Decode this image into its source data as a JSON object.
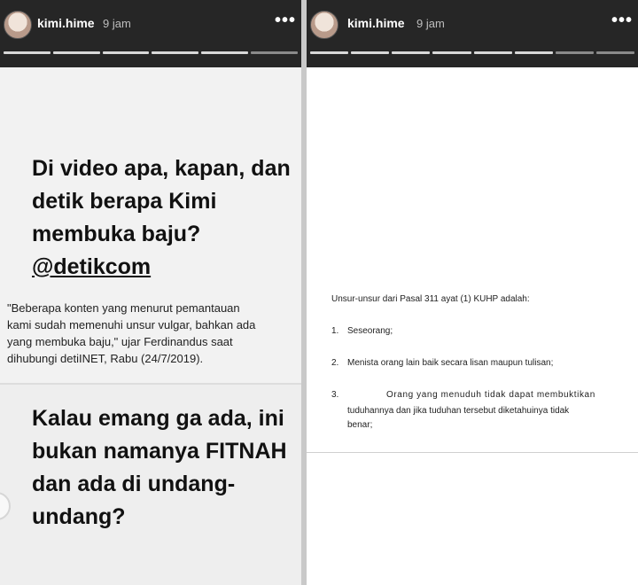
{
  "left_story": {
    "username": "kimi.hime",
    "time": "9 jam",
    "more": "•••",
    "headline_lines": [
      "Di video apa, kapan, dan",
      "detik berapa Kimi",
      "membuka baju?"
    ],
    "mention": "@detikcom",
    "quote_lines": [
      "\"Beberapa konten yang menurut pemantauan",
      "kami sudah memenuhi unsur vulgar, bahkan ada",
      "yang membuka baju,\" ujar Ferdinandus saat",
      "dihubungi detiINET, Rabu (24/7/2019)."
    ],
    "headline2_lines": [
      "Kalau emang ga ada, ini",
      "bukan namanya FITNAH",
      "dan ada di undang-",
      "undang?"
    ]
  },
  "right_story": {
    "username": "kimi.hime",
    "time": "9 jam",
    "more": "•••",
    "doc_heading": "Unsur-unsur dari Pasal 311 ayat (1) KUHP adalah:",
    "items": [
      {
        "num": "1.",
        "text": "Seseorang;"
      },
      {
        "num": "2.",
        "text": "Menista orang lain baik secara lisan maupun tulisan;"
      },
      {
        "num": "3.",
        "text": "Orang yang menuduh tidak dapat membuktikan"
      }
    ],
    "item3_lines": [
      "tuduhannya dan jika tuduhan tersebut diketahuinya tidak",
      "benar;"
    ]
  }
}
